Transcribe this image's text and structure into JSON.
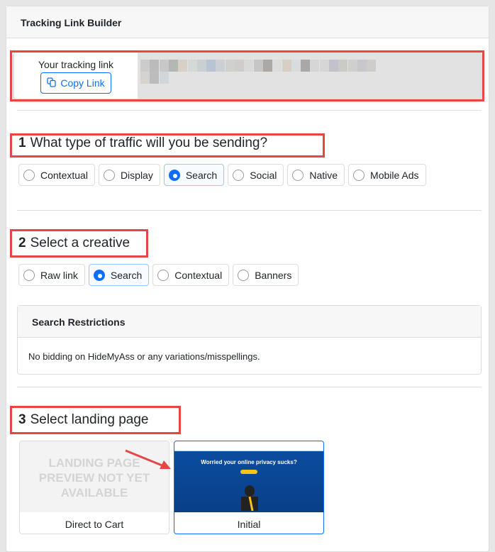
{
  "title": "Tracking Link Builder",
  "tracking": {
    "label": "Your tracking link",
    "copy": "Copy Link"
  },
  "step1": {
    "num": "1",
    "title": "What type of traffic will you be sending?",
    "options": [
      "Contextual",
      "Display",
      "Search",
      "Social",
      "Native",
      "Mobile Ads"
    ],
    "selected": "Search"
  },
  "step2": {
    "num": "2",
    "title": "Select a creative",
    "options": [
      "Raw link",
      "Search",
      "Contextual",
      "Banners"
    ],
    "selected": "Search"
  },
  "restrictions": {
    "title": "Search Restrictions",
    "text": "No bidding on HideMyAss or any variations/misspellings."
  },
  "step3": {
    "num": "3",
    "title": "Select landing page",
    "pages": [
      {
        "placeholder": "LANDING PAGE PREVIEW NOT YET AVAILABLE",
        "label": "Direct to Cart"
      },
      {
        "headline": "Worried your online privacy sucks?",
        "label": "Initial"
      }
    ],
    "selected": "Initial"
  },
  "colors": {
    "accent": "#0d6efd",
    "annotation": "#e84545"
  }
}
